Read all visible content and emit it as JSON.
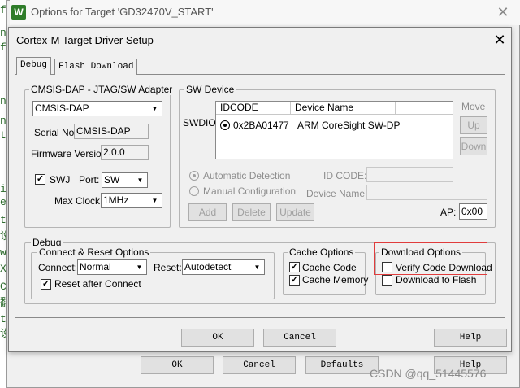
{
  "code_strip": [
    "f",
    "n",
    "f",
    "",
    "n",
    "n",
    "t",
    "",
    "i",
    "e",
    "t",
    "设",
    "w",
    "X",
    "C",
    "翻",
    "t",
    "设"
  ],
  "outer_window": {
    "title": "Options for Target 'GD32470V_START'",
    "icon_text": "W",
    "close_glyph": "✕",
    "buttons": {
      "ok": "OK",
      "cancel": "Cancel",
      "defaults": "Defaults",
      "help": "Help"
    }
  },
  "inner_window": {
    "title": "Cortex-M Target Driver Setup",
    "close_glyph": "✕",
    "tabs": [
      "Debug",
      "Flash Download"
    ],
    "buttons": {
      "ok": "OK",
      "cancel": "Cancel",
      "help": "Help"
    }
  },
  "adapter": {
    "group_label": "CMSIS-DAP - JTAG/SW Adapter",
    "adapter_value": "CMSIS-DAP",
    "serial_label": "Serial No:",
    "serial_value": "CMSIS-DAP",
    "firmware_label": "Firmware Version:",
    "firmware_value": "2.0.0",
    "swj_label": "SWJ",
    "swj_checked": true,
    "port_label": "Port:",
    "port_value": "SW",
    "maxclock_label": "Max Clock:",
    "maxclock_value": "1MHz"
  },
  "sw_device": {
    "group_label": "SW Device",
    "swdio_label": "SWDIO",
    "columns": [
      "IDCODE",
      "Device Name"
    ],
    "rows": [
      {
        "idcode": "0x2BA01477",
        "name": "ARM CoreSight SW-DP"
      }
    ],
    "move_label": "Move",
    "up_label": "Up",
    "down_label": "Down",
    "auto_detect_label": "Automatic Detection",
    "manual_config_label": "Manual Configuration",
    "idcode_label": "ID CODE:",
    "device_name_label": "Device Name:",
    "add_label": "Add",
    "delete_label": "Delete",
    "update_label": "Update",
    "ap_label": "AP:",
    "ap_value": "0x00"
  },
  "debug": {
    "group_label": "Debug",
    "connect_reset": {
      "group_label": "Connect & Reset Options",
      "connect_label": "Connect:",
      "connect_value": "Normal",
      "reset_label": "Reset:",
      "reset_value": "Autodetect",
      "reset_after_connect_label": "Reset after Connect",
      "reset_after_connect_checked": true
    },
    "cache": {
      "group_label": "Cache Options",
      "cache_code_label": "Cache Code",
      "cache_code_checked": true,
      "cache_memory_label": "Cache Memory",
      "cache_memory_checked": true
    },
    "download": {
      "group_label": "Download Options",
      "verify_label": "Verify Code Download",
      "verify_checked": false,
      "download_flash_label": "Download to Flash",
      "download_flash_checked": false
    }
  },
  "watermark": "CSDN @qq_51445576",
  "check_glyph": "✓",
  "icons": [
    "combo-arrow-icon",
    "close-icon",
    "check-icon",
    "radio-icon"
  ]
}
